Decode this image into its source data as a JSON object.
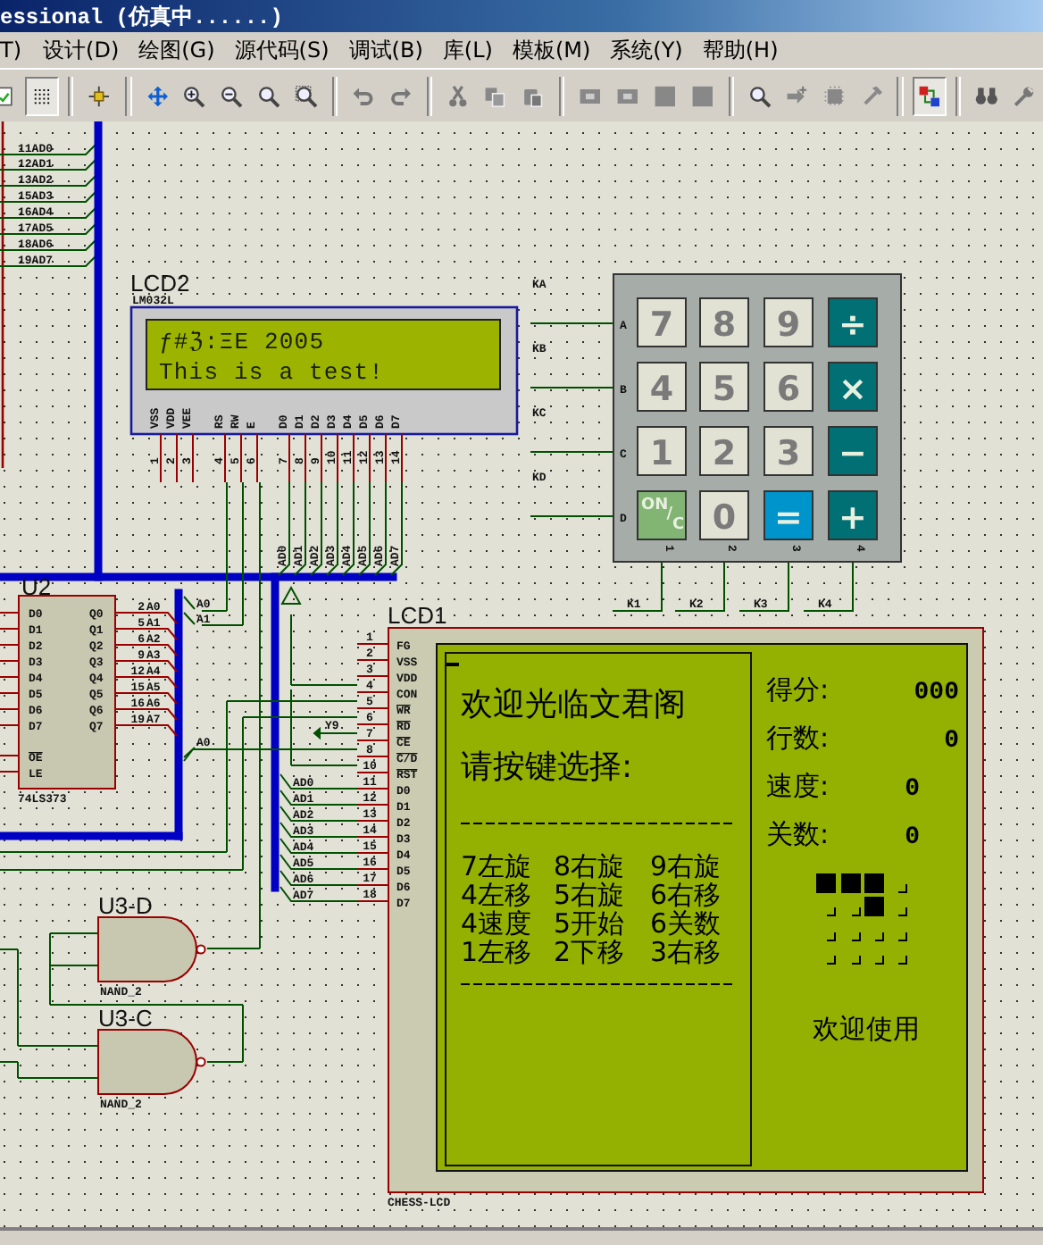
{
  "window": {
    "title": "essional (仿真中......)"
  },
  "menu": [
    "T)",
    "设计(D)",
    "绘图(G)",
    "源代码(S)",
    "调试(B)",
    "库(L)",
    "模板(M)",
    "系统(Y)",
    "帮助(H)"
  ],
  "toolbar": [
    [
      {
        "kind": "page",
        "pressed": false
      },
      {
        "kind": "grid",
        "pressed": true
      }
    ],
    [
      {
        "kind": "origin",
        "pressed": false
      }
    ],
    [
      {
        "kind": "move",
        "pressed": false
      },
      {
        "kind": "zoom-in",
        "pressed": false
      },
      {
        "kind": "zoom-out",
        "pressed": false
      },
      {
        "kind": "zoom",
        "pressed": false
      },
      {
        "kind": "zoom-area",
        "pressed": false
      }
    ],
    [
      {
        "kind": "undo",
        "pressed": false
      },
      {
        "kind": "redo",
        "pressed": false
      }
    ],
    [
      {
        "kind": "cut",
        "pressed": false
      },
      {
        "kind": "copy",
        "pressed": false
      },
      {
        "kind": "paste",
        "pressed": false
      }
    ],
    [
      {
        "kind": "block",
        "pressed": false
      },
      {
        "kind": "block",
        "pressed": false
      },
      {
        "kind": "square",
        "pressed": false
      },
      {
        "kind": "square",
        "pressed": false
      }
    ],
    [
      {
        "kind": "search",
        "pressed": false
      },
      {
        "kind": "probe",
        "pressed": false
      },
      {
        "kind": "chip",
        "pressed": false
      },
      {
        "kind": "hammer",
        "pressed": false
      }
    ],
    [
      {
        "kind": "netlist",
        "pressed": true
      }
    ],
    [
      {
        "kind": "binoculars",
        "pressed": false
      },
      {
        "kind": "wrench",
        "pressed": false
      }
    ]
  ],
  "address_nets": [
    "11AD0",
    "12AD1",
    "13AD2",
    "15AD3",
    "16AD4",
    "17AD5",
    "18AD6",
    "19AD7"
  ],
  "lcd2": {
    "ref": "LCD2",
    "part": "LM032L",
    "lines": [
      "ƒ#ℨ:ΞE 2005",
      "This is a test!"
    ],
    "pins": [
      {
        "name": "VSS",
        "number": "1"
      },
      {
        "name": "VDD",
        "number": "2"
      },
      {
        "name": "VEE",
        "number": "3"
      },
      {
        "name": "RS",
        "number": "4"
      },
      {
        "name": "RW",
        "number": "5"
      },
      {
        "name": "E",
        "number": "6"
      },
      {
        "name": "D0",
        "number": "7"
      },
      {
        "name": "D1",
        "number": "8"
      },
      {
        "name": "D2",
        "number": "9"
      },
      {
        "name": "D3",
        "number": "10"
      },
      {
        "name": "D4",
        "number": "11"
      },
      {
        "name": "D5",
        "number": "12"
      },
      {
        "name": "D6",
        "number": "13"
      },
      {
        "name": "D7",
        "number": "14"
      }
    ],
    "bus_labels": [
      "AD0",
      "AD1",
      "AD2",
      "AD3",
      "AD4",
      "AD5",
      "AD6",
      "AD7"
    ]
  },
  "keypad": {
    "row_nets": [
      "KA",
      "KB",
      "KC",
      "KD"
    ],
    "row_pins": [
      "A",
      "B",
      "C",
      "D"
    ],
    "keys": [
      {
        "label": "7",
        "kind": "digit"
      },
      {
        "label": "8",
        "kind": "digit"
      },
      {
        "label": "9",
        "kind": "digit"
      },
      {
        "label": "÷",
        "kind": "operator"
      },
      {
        "label": "4",
        "kind": "digit"
      },
      {
        "label": "5",
        "kind": "digit"
      },
      {
        "label": "6",
        "kind": "digit"
      },
      {
        "label": "×",
        "kind": "operator"
      },
      {
        "label": "1",
        "kind": "digit"
      },
      {
        "label": "2",
        "kind": "digit"
      },
      {
        "label": "3",
        "kind": "digit"
      },
      {
        "label": "−",
        "kind": "operator"
      },
      {
        "label": "ON/C",
        "kind": "clear"
      },
      {
        "label": "0",
        "kind": "digit"
      },
      {
        "label": "=",
        "kind": "equals"
      },
      {
        "label": "+",
        "kind": "operator"
      }
    ],
    "column_pins": [
      "1",
      "2",
      "3",
      "4"
    ],
    "column_nets": [
      "K1",
      "K2",
      "K3",
      "K4"
    ]
  },
  "u2": {
    "ref": "U2",
    "part": "74LS373",
    "inputs": [
      "D0",
      "D1",
      "D2",
      "D3",
      "D4",
      "D5",
      "D6",
      "D7"
    ],
    "controls": [
      {
        "name": "OE",
        "inverted": true
      },
      {
        "name": "LE",
        "inverted": false
      }
    ],
    "outputs": [
      {
        "name": "Q0",
        "number": "2",
        "net": "A0"
      },
      {
        "name": "Q1",
        "number": "5",
        "net": "A1"
      },
      {
        "name": "Q2",
        "number": "6",
        "net": "A2"
      },
      {
        "name": "Q3",
        "number": "9",
        "net": "A3"
      },
      {
        "name": "Q4",
        "number": "12",
        "net": "A4"
      },
      {
        "name": "Q5",
        "number": "15",
        "net": "A5"
      },
      {
        "name": "Q6",
        "number": "16",
        "net": "A6"
      },
      {
        "name": "Q7",
        "number": "19",
        "net": "A7"
      }
    ]
  },
  "bus_nets": [
    "A0",
    "A1",
    "A0"
  ],
  "signal_net": "Y9",
  "lcd1": {
    "ref": "LCD1",
    "part": "CHESS-LCD",
    "pins": [
      {
        "number": "1",
        "name": "FG",
        "inverted": false
      },
      {
        "number": "2",
        "name": "VSS",
        "inverted": false
      },
      {
        "number": "3",
        "name": "VDD",
        "inverted": false
      },
      {
        "number": "4",
        "name": "CON",
        "inverted": false
      },
      {
        "number": "5",
        "name": "WR",
        "inverted": true
      },
      {
        "number": "6",
        "name": "RD",
        "inverted": true
      },
      {
        "number": "7",
        "name": "CE",
        "inverted": true
      },
      {
        "number": "8",
        "name": "C/D",
        "inverted": true
      },
      {
        "number": "10",
        "name": "RST",
        "inverted": true
      },
      {
        "number": "11",
        "name": "D0",
        "inverted": false
      },
      {
        "number": "12",
        "name": "D1",
        "inverted": false
      },
      {
        "number": "13",
        "name": "D2",
        "inverted": false
      },
      {
        "number": "14",
        "name": "D3",
        "inverted": false
      },
      {
        "number": "15",
        "name": "D4",
        "inverted": false
      },
      {
        "number": "16",
        "name": "D5",
        "inverted": false
      },
      {
        "number": "17",
        "name": "D6",
        "inverted": false
      },
      {
        "number": "18",
        "name": "D7",
        "inverted": false
      }
    ],
    "data_nets": [
      "AD0",
      "AD1",
      "AD2",
      "AD3",
      "AD4",
      "AD5",
      "AD6",
      "AD7"
    ],
    "screen": {
      "title": "欢迎光临文君阁",
      "prompt": "请按键选择:",
      "options": [
        "7左旋",
        "8右旋",
        "9右旋",
        "4左移",
        "5右旋",
        "6右移",
        "4速度",
        "5开始",
        "6关数",
        "1左移",
        "2下移",
        "3右移"
      ],
      "stats": [
        {
          "label": "得分:",
          "value": "000"
        },
        {
          "label": "行数:",
          "value": "0"
        },
        {
          "label": "速度:",
          "value": "0"
        },
        {
          "label": "关数:",
          "value": "0"
        }
      ],
      "blocks": [
        {
          "filled": true
        },
        {
          "filled": true
        },
        {
          "filled": true
        },
        {
          "filled": false
        },
        {
          "filled": false
        },
        {
          "filled": false
        },
        {
          "filled": true
        },
        {
          "filled": false
        },
        {
          "filled": false
        },
        {
          "filled": false
        },
        {
          "filled": false
        },
        {
          "filled": false
        },
        {
          "filled": false
        },
        {
          "filled": false
        },
        {
          "filled": false
        },
        {
          "filled": false
        }
      ],
      "footer": "欢迎使用"
    }
  },
  "gates": [
    {
      "ref": "U3-D",
      "part": "NAND_2"
    },
    {
      "ref": "U3-C",
      "part": "NAND_2"
    }
  ]
}
